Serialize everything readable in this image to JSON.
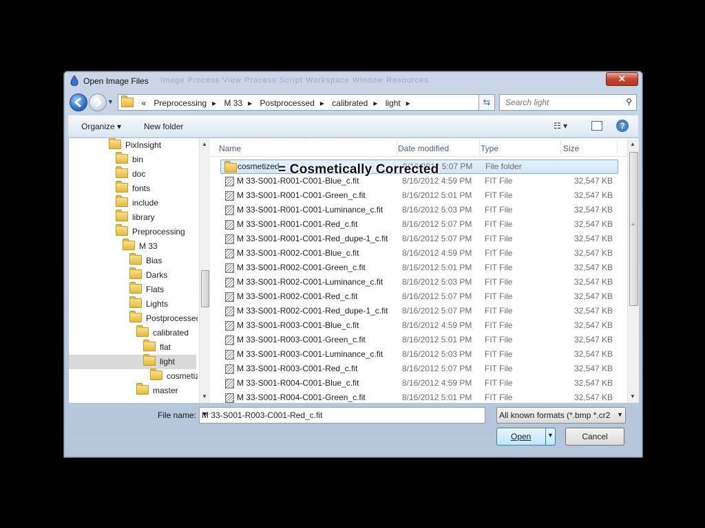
{
  "window": {
    "title": "Open Image Files",
    "ghost_menu": "Image   Process   View   Process   Script   Workspace   Window   Resources",
    "close_label": "✕"
  },
  "nav": {
    "crumb_prefix": "«",
    "breadcrumbs": [
      "Preprocessing",
      "M 33",
      "Postprocessed",
      "calibrated",
      "light"
    ],
    "search_placeholder": "Search light"
  },
  "toolbar": {
    "organize_label": "Organize ▾",
    "new_folder_label": "New folder"
  },
  "tree": {
    "items": [
      {
        "label": "PixInsight"
      },
      {
        "label": "bin"
      },
      {
        "label": "doc"
      },
      {
        "label": "fonts"
      },
      {
        "label": "include"
      },
      {
        "label": "library"
      },
      {
        "label": "Preprocessing"
      },
      {
        "label": "M 33"
      },
      {
        "label": "Bias"
      },
      {
        "label": "Darks"
      },
      {
        "label": "Flats"
      },
      {
        "label": "Lights"
      },
      {
        "label": "Postprocessed"
      },
      {
        "label": "calibrated"
      },
      {
        "label": "flat"
      },
      {
        "label": "light"
      },
      {
        "label": "cosmetiz"
      },
      {
        "label": "master"
      }
    ],
    "selected": "light"
  },
  "list": {
    "columns": [
      "Name",
      "Date modified",
      "Type",
      "Size"
    ],
    "rows": [
      {
        "name": "cosmetized",
        "date": "8/16/2012 5:07 PM",
        "type": "File folder",
        "size": "",
        "kind": "folder"
      },
      {
        "name": "M 33-S001-R001-C001-Blue_c.fit",
        "date": "8/16/2012 4:59 PM",
        "type": "FIT File",
        "size": "32,547 KB",
        "kind": "fit"
      },
      {
        "name": "M 33-S001-R001-C001-Green_c.fit",
        "date": "8/16/2012 5:01 PM",
        "type": "FIT File",
        "size": "32,547 KB",
        "kind": "fit"
      },
      {
        "name": "M 33-S001-R001-C001-Luminance_c.fit",
        "date": "8/16/2012 5:03 PM",
        "type": "FIT File",
        "size": "32,547 KB",
        "kind": "fit"
      },
      {
        "name": "M 33-S001-R001-C001-Red_c.fit",
        "date": "8/16/2012 5:07 PM",
        "type": "FIT File",
        "size": "32,547 KB",
        "kind": "fit"
      },
      {
        "name": "M 33-S001-R001-C001-Red_dupe-1_c.fit",
        "date": "8/16/2012 5:07 PM",
        "type": "FIT File",
        "size": "32,547 KB",
        "kind": "fit"
      },
      {
        "name": "M 33-S001-R002-C001-Blue_c.fit",
        "date": "8/16/2012 4:59 PM",
        "type": "FIT File",
        "size": "32,547 KB",
        "kind": "fit"
      },
      {
        "name": "M 33-S001-R002-C001-Green_c.fit",
        "date": "8/16/2012 5:01 PM",
        "type": "FIT File",
        "size": "32,547 KB",
        "kind": "fit"
      },
      {
        "name": "M 33-S001-R002-C001-Luminance_c.fit",
        "date": "8/16/2012 5:03 PM",
        "type": "FIT File",
        "size": "32,547 KB",
        "kind": "fit"
      },
      {
        "name": "M 33-S001-R002-C001-Red_c.fit",
        "date": "8/16/2012 5:07 PM",
        "type": "FIT File",
        "size": "32,547 KB",
        "kind": "fit"
      },
      {
        "name": "M 33-S001-R002-C001-Red_dupe-1_c.fit",
        "date": "8/16/2012 5:07 PM",
        "type": "FIT File",
        "size": "32,547 KB",
        "kind": "fit"
      },
      {
        "name": "M 33-S001-R003-C001-Blue_c.fit",
        "date": "8/16/2012 4:59 PM",
        "type": "FIT File",
        "size": "32,547 KB",
        "kind": "fit"
      },
      {
        "name": "M 33-S001-R003-C001-Green_c.fit",
        "date": "8/16/2012 5:01 PM",
        "type": "FIT File",
        "size": "32,547 KB",
        "kind": "fit"
      },
      {
        "name": "M 33-S001-R003-C001-Luminance_c.fit",
        "date": "8/16/2012 5:03 PM",
        "type": "FIT File",
        "size": "32,547 KB",
        "kind": "fit"
      },
      {
        "name": "M 33-S001-R003-C001-Red_c.fit",
        "date": "8/16/2012 5:07 PM",
        "type": "FIT File",
        "size": "32,547 KB",
        "kind": "fit"
      },
      {
        "name": "M 33-S001-R004-C001-Blue_c.fit",
        "date": "8/16/2012 4:59 PM",
        "type": "FIT File",
        "size": "32,547 KB",
        "kind": "fit"
      },
      {
        "name": "M 33-S001-R004-C001-Green_c.fit",
        "date": "8/16/2012 5:01 PM",
        "type": "FIT File",
        "size": "32,547 KB",
        "kind": "fit"
      }
    ],
    "annotation": "= Cosmetically Corrected"
  },
  "footer": {
    "file_name_label": "File name:",
    "file_name_value": "M 33-S001-R003-C001-Red_c.fit",
    "filter_value": "All known formats (*.bmp *.cr2",
    "open_label": "Open",
    "cancel_label": "Cancel"
  }
}
